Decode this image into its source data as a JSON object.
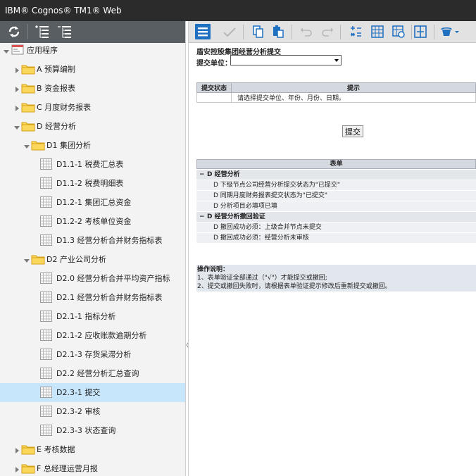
{
  "window": {
    "title": "IBM® Cognos® TM1® Web"
  },
  "icons": {
    "refresh": "refresh-icon",
    "collapse": "collapse-tree-icon",
    "expand": "expand-tree-icon",
    "folder": "folder-icon",
    "grid": "cube-view-icon",
    "app": "application-icon"
  },
  "colors": {
    "title_bar": "#2b2b2b",
    "left_toolbar": "#585e61",
    "accent": "#1f70c1",
    "selected_row": "#c8e6fb",
    "folder": "#f1c232"
  },
  "tree": {
    "items": [
      {
        "label": "应用程序",
        "level": 0,
        "type": "app",
        "expanded": true
      },
      {
        "label": "A 预算编制",
        "level": 1,
        "type": "folder",
        "expanded": false
      },
      {
        "label": "B 资金报表",
        "level": 1,
        "type": "folder",
        "expanded": false
      },
      {
        "label": "C 月度财务报表",
        "level": 1,
        "type": "folder",
        "expanded": false
      },
      {
        "label": "D 经营分析",
        "level": 1,
        "type": "folder",
        "expanded": true
      },
      {
        "label": "D1 集团分析",
        "level": 2,
        "type": "folder",
        "expanded": true
      },
      {
        "label": "D1.1-1 税费汇总表",
        "level": 3,
        "type": "view"
      },
      {
        "label": "D1.1-2 税费明细表",
        "level": 3,
        "type": "view"
      },
      {
        "label": "D1.2-1 集团汇总资金",
        "level": 3,
        "type": "view"
      },
      {
        "label": "D1.2-2 考核单位资金",
        "level": 3,
        "type": "view"
      },
      {
        "label": "D1.3 经营分析合并财务指标表",
        "level": 3,
        "type": "view"
      },
      {
        "label": "D2 产业公司分析",
        "level": 2,
        "type": "folder",
        "expanded": true
      },
      {
        "label": "D2.0 经营分析合并平均资产指标",
        "level": 3,
        "type": "view"
      },
      {
        "label": "D2.1 经营分析合并财务指标表",
        "level": 3,
        "type": "view"
      },
      {
        "label": "D2.1-1 指标分析",
        "level": 3,
        "type": "view"
      },
      {
        "label": "D2.1-2 应收账款逾期分析",
        "level": 3,
        "type": "view"
      },
      {
        "label": "D2.1-3 存货呆滞分析",
        "level": 3,
        "type": "view"
      },
      {
        "label": "D2.2 经营分析汇总查询",
        "level": 3,
        "type": "view"
      },
      {
        "label": "D2.3-1 提交",
        "level": 3,
        "type": "view",
        "selected": true
      },
      {
        "label": "D2.3-2 审核",
        "level": 3,
        "type": "view"
      },
      {
        "label": "D2.3-3 状态查询",
        "level": 3,
        "type": "view"
      },
      {
        "label": "E 考核数据",
        "level": 1,
        "type": "folder",
        "expanded": false
      },
      {
        "label": "F 总经理运营月报",
        "level": 1,
        "type": "folder",
        "expanded": false
      }
    ]
  },
  "toolbar": {
    "icons": [
      "menu-icon",
      "commit-check-icon",
      "copy-icon",
      "paste-icon",
      "undo-icon",
      "redo-icon",
      "calculate-icon",
      "view-table-icon",
      "view-settings-icon",
      "fit-columns-icon",
      "paint-bucket-icon"
    ]
  },
  "content": {
    "title": "盾安控股集团经营分析提交",
    "unit_label": "提交单位：",
    "unit_value": "",
    "status_table": {
      "headers": [
        "提交状态",
        "提示"
      ],
      "rows": [
        [
          "",
          "请选择提交单位、年份、月份、日期。"
        ]
      ]
    },
    "submit_label": "提交",
    "form_header": "表单",
    "form_rows": [
      {
        "text": "D 经营分析",
        "group": true
      },
      {
        "text": "D 下级节点公司经营分析提交状态为\"已提交\"",
        "group": false
      },
      {
        "text": "D 同期月度财务报表提交状态为\"已提交\"",
        "group": false
      },
      {
        "text": "D 分析项目必填项已填",
        "group": false
      },
      {
        "text": "D 经营分析撤回验证",
        "group": true
      },
      {
        "text": "D 撤回成功必须：上级合并节点未提交",
        "group": false
      },
      {
        "text": "D 撤回成功必须：经营分析未审核",
        "group": false
      }
    ],
    "notes": {
      "title": "操作说明：",
      "lines": [
        "1、表单验证全部通过（\"√\"）才能提交或撤回;",
        "2、提交或撤回失败时，请根据表单验证提示修改后重新提交或撤回。"
      ]
    }
  }
}
